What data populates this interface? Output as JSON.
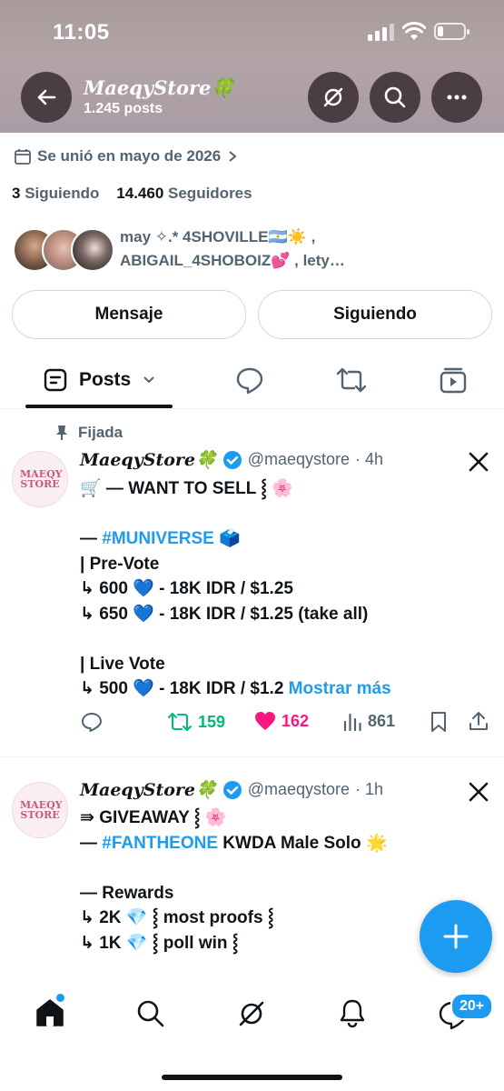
{
  "status_bar": {
    "time": "11:05"
  },
  "header": {
    "title": "𝑴𝒂𝒆𝒒𝒚𝑺𝒕𝒐𝒓𝒆🍀",
    "post_count": "1.245 posts"
  },
  "profile": {
    "joined": "Se unió en mayo de 2026",
    "following_count": "3",
    "following_label": "Siguiendo",
    "followers_count": "14.460",
    "followers_label": "Seguidores",
    "followed_by_line1": "may ✧.* 4SHOVILLE🇦🇷☀️ ,",
    "followed_by_line2": "ABIGAIL_4SHOBOIZ💕 , lety…",
    "message_button": "Mensaje",
    "following_button": "Siguiendo"
  },
  "tabs": {
    "active_label": "Posts"
  },
  "tweets": [
    {
      "pinned_label": "Fijada",
      "name": "𝑴𝒂𝒆𝒒𝒚𝑺𝒕𝒐𝒓𝒆🍀",
      "handle": "@maeqystore",
      "time": "· 4h",
      "avatar_text": "MAEQY STORE",
      "lines": [
        "🛒 — WANT TO SELL ⸾ 🌸",
        "— ",
        "#MUNIVERSE",
        " 🗳️",
        "| Pre-Vote",
        "↳ 600 💙 - 18K IDR / $1.25",
        "↳ 650 💙 - 18K IDR / $1.25 (take all)",
        "| Live Vote",
        "↳ 500 💙 - 18K IDR / $1.2 ",
        "Mostrar más"
      ],
      "retweets": "159",
      "likes": "162",
      "views": "861"
    },
    {
      "name": "𝑴𝒂𝒆𝒒𝒚𝑺𝒕𝒐𝒓𝒆🍀",
      "handle": "@maeqystore",
      "time": "· 1h",
      "avatar_text": "MAEQY STORE",
      "lines": [
        "⇛ GIVEAWAY ⸾ 🌸",
        "— ",
        "#FANTHEONE",
        " KWDA Male Solo 🌟",
        "— Rewards",
        "↳ 2K 💎 ⸾ most proofs ⸾",
        "↳ 1K 💎 ⸾ poll win ⸾"
      ]
    }
  ],
  "bottom_nav": {
    "messages_badge": "20+"
  },
  "colors": {
    "accent": "#1d9bf0",
    "retweet": "#00ba7c",
    "like": "#f91880",
    "text": "#0f1419",
    "muted": "#536471"
  }
}
